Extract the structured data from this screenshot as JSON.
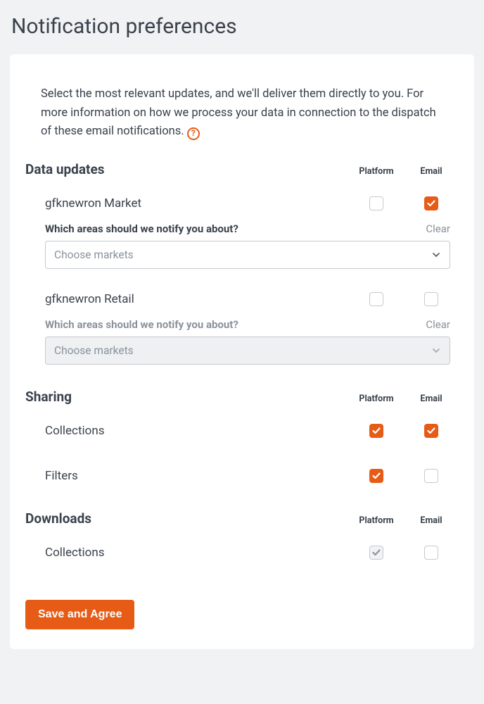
{
  "page_title": "Notification preferences",
  "intro_text": "Select the most relevant updates, and we'll deliver them directly to you. For more information on how we process your data in connection to the dispatch of these email notifications.",
  "help_icon_label": "?",
  "columns": {
    "platform": "Platform",
    "email": "Email"
  },
  "clear_label": "Clear",
  "select_placeholder": "Choose markets",
  "areas_prompt": "Which areas should we notify you about?",
  "sections": {
    "data_updates": {
      "title": "Data updates",
      "items": [
        {
          "label": "gfknewron Market",
          "platform_checked": false,
          "email_checked": true,
          "has_areas": true,
          "areas_disabled": false
        },
        {
          "label": "gfknewron Retail",
          "platform_checked": false,
          "email_checked": false,
          "has_areas": true,
          "areas_disabled": true
        }
      ]
    },
    "sharing": {
      "title": "Sharing",
      "items": [
        {
          "label": "Collections",
          "platform_checked": true,
          "email_checked": true
        },
        {
          "label": "Filters",
          "platform_checked": true,
          "email_checked": false
        }
      ]
    },
    "downloads": {
      "title": "Downloads",
      "items": [
        {
          "label": "Collections",
          "platform_checked": true,
          "platform_disabled": true,
          "email_checked": false
        }
      ]
    }
  },
  "save_button": "Save and Agree"
}
